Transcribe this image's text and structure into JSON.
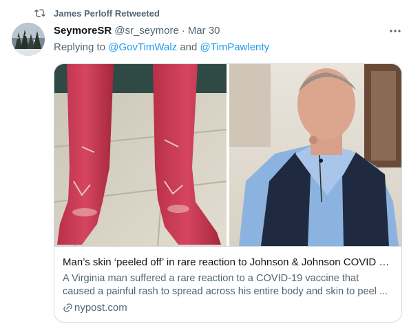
{
  "retweet": {
    "label": "James Perloff Retweeted"
  },
  "author": {
    "name": "SeymoreSR",
    "handle": "@sr_seymore",
    "separator": "·",
    "date": "Mar 30"
  },
  "reply": {
    "prefix": "Replying to ",
    "user1": "@GovTimWalz",
    "joiner": " and ",
    "user2": "@TimPawlenty"
  },
  "more": {
    "label": "···"
  },
  "card": {
    "title": "Man’s skin ‘peeled off’ in rare reaction to Johnson & Johnson COVID va...",
    "desc_line1": "A Virginia man suffered a rare reaction to a COVID-19 vaccine that",
    "desc_line2": "caused a painful rash to spread across his entire body and skin to peel ...",
    "domain": "nypost.com"
  },
  "colors": {
    "link": "#1d9bf0",
    "muted": "#536471",
    "text": "#0f1419",
    "border": "#cfd9de"
  },
  "icons": {
    "retweet": "retweet-icon",
    "more": "more-icon",
    "link": "link-icon"
  }
}
